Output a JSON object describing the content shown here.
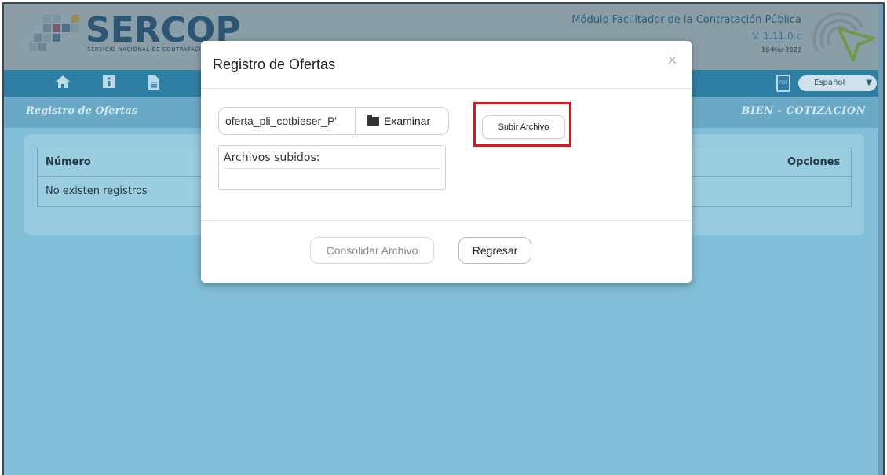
{
  "header": {
    "logo_text": "SERCOP",
    "logo_subtitle": "SERVICIO NACIONAL DE CONTRATACIÓN",
    "module_title": "Módulo Facilitador de la Contratación Pública",
    "version": "V. 1.11.0.c",
    "date": "16-Mar-2022"
  },
  "navbar": {
    "icons": [
      "home-icon",
      "info-icon",
      "document-icon"
    ],
    "pdf_label": "PDF",
    "language": "Español"
  },
  "subheader": {
    "left": "Registro de Ofertas",
    "right": "BIEN - COTIZACION"
  },
  "table": {
    "columns": [
      "Número",
      "Opciones"
    ],
    "empty_text": "No existen registros"
  },
  "modal": {
    "title": "Registro de Ofertas",
    "close": "×",
    "file_value": "oferta_pli_cotbieser_P'",
    "browse_label": "Examinar",
    "upload_label": "Subir Archivo",
    "uploaded_title": "Archivos subidos:",
    "consolidate_label": "Consolidar Archivo",
    "back_label": "Regresar"
  },
  "colors": {
    "highlight": "#e0141e",
    "navbar": "#2f7fa5",
    "backdrop": "#80bfd7"
  }
}
